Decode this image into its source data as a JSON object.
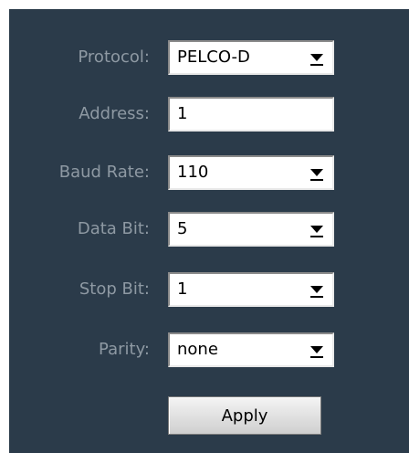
{
  "form": {
    "protocol": {
      "label": "Protocol:",
      "value": "PELCO-D"
    },
    "address": {
      "label": "Address:",
      "value": "1"
    },
    "baud_rate": {
      "label": "Baud Rate:",
      "value": "110"
    },
    "data_bit": {
      "label": "Data Bit:",
      "value": "5"
    },
    "stop_bit": {
      "label": "Stop Bit:",
      "value": "1"
    },
    "parity": {
      "label": "Parity:",
      "value": "none"
    },
    "apply_label": "Apply"
  },
  "icons": {
    "dropdown": "dropdown-arrow-icon"
  },
  "colors": {
    "panel_bg": "#2b3b4a",
    "label_text": "#8e99a3"
  }
}
